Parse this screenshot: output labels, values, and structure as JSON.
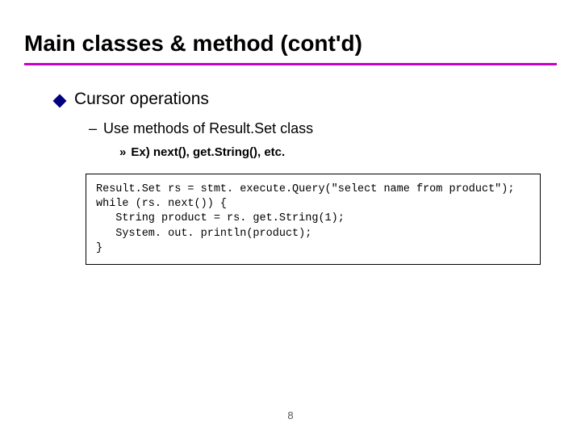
{
  "title": "Main classes & method (cont'd)",
  "bullet1": "Cursor operations",
  "bullet2_dash": "–",
  "bullet2": "Use methods of Result.Set class",
  "bullet3_marker": "»",
  "bullet3": "Ex) next(), get.String(), etc.",
  "code": "Result.Set rs = stmt. execute.Query(\"select name from product\");\nwhile (rs. next()) {\n   String product = rs. get.String(1);\n   System. out. println(product);\n}",
  "page_number": "8"
}
